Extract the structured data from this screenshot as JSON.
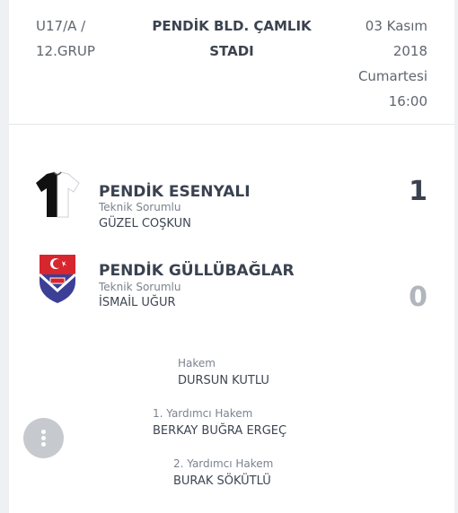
{
  "match": {
    "league": [
      "U17/A /",
      "12.GRUP"
    ],
    "venue": [
      "PENDİK BLD. ÇAMLIK",
      "STADI"
    ],
    "datetime": [
      "03 Kasım",
      "2018",
      "Cumartesi",
      "16:00"
    ]
  },
  "teams": [
    {
      "name": "PENDİK ESENYALI",
      "coach_label": "Teknik Sorumlu",
      "coach": "GÜZEL COŞKUN",
      "score": "1",
      "logo_icon": "black-white-jersey-icon"
    },
    {
      "name": "PENDİK GÜLLÜBAĞLAR",
      "coach_label": "Teknik Sorumlu",
      "coach": "İSMAİL UĞUR",
      "score": "0",
      "logo_icon": "club-crest-icon"
    }
  ],
  "officials": [
    {
      "role": "Hakem",
      "name": "DURSUN KUTLU"
    },
    {
      "role": "1. Yardımcı Hakem",
      "name": "BERKAY BUĞRA ERGEÇ"
    },
    {
      "role": "2. Yardımcı Hakem",
      "name": "BURAK SÖKÜTLÜ"
    }
  ],
  "fab_icon": "more-vertical-icon",
  "colors": {
    "text_dark": "#3a4250",
    "text_muted": "#7b838d",
    "score_zero": "#b1b6bd",
    "crest_red": "#d7262d",
    "crest_blue": "#3b3f96"
  }
}
